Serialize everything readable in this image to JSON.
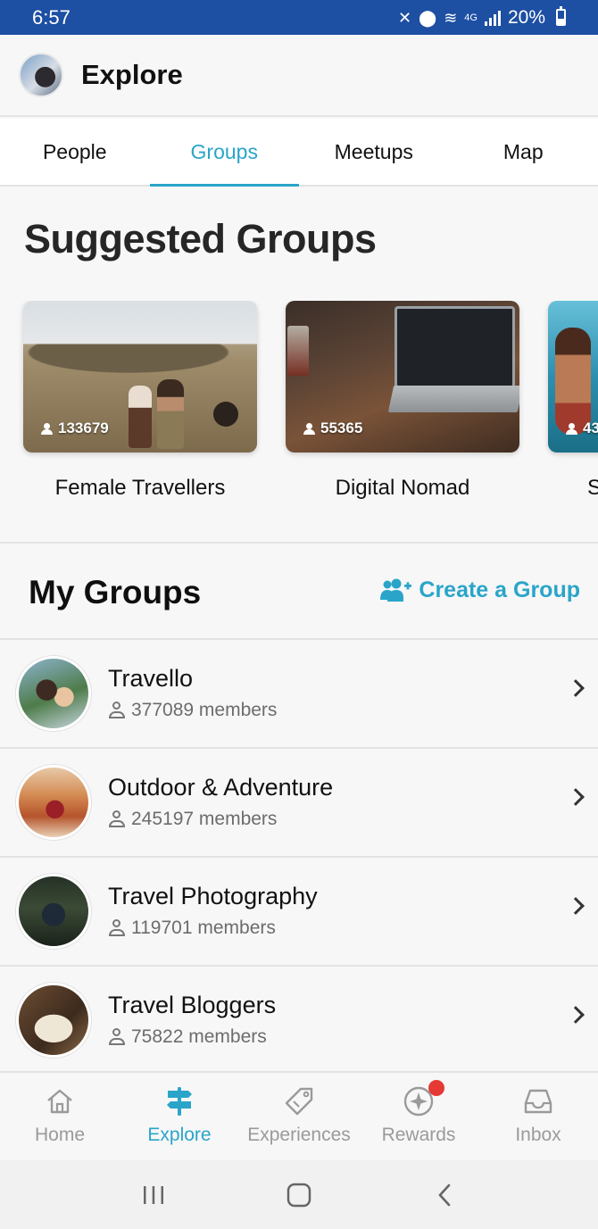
{
  "status_bar": {
    "time": "6:57",
    "network": "4G",
    "battery": "20%"
  },
  "header": {
    "title": "Explore"
  },
  "tabs": [
    {
      "label": "People",
      "active": false
    },
    {
      "label": "Groups",
      "active": true
    },
    {
      "label": "Meetups",
      "active": false
    },
    {
      "label": "Map",
      "active": false
    }
  ],
  "suggested": {
    "title": "Suggested Groups",
    "cards": [
      {
        "name": "Female Travellers",
        "members": "133679"
      },
      {
        "name": "Digital Nomad",
        "members": "55365"
      },
      {
        "name": "S",
        "members": "43"
      }
    ]
  },
  "my_groups": {
    "title": "My Groups",
    "create_label": "Create a Group",
    "items": [
      {
        "name": "Travello",
        "members": "377089 members"
      },
      {
        "name": "Outdoor & Adventure",
        "members": "245197 members"
      },
      {
        "name": "Travel Photography",
        "members": "119701 members"
      },
      {
        "name": "Travel Bloggers",
        "members": "75822 members"
      }
    ]
  },
  "bottom_nav": [
    {
      "label": "Home",
      "icon": "home-icon",
      "active": false
    },
    {
      "label": "Explore",
      "icon": "signpost-icon",
      "active": true
    },
    {
      "label": "Experiences",
      "icon": "tag-icon",
      "active": false
    },
    {
      "label": "Rewards",
      "icon": "star-badge-icon",
      "active": false,
      "notification": true
    },
    {
      "label": "Inbox",
      "icon": "inbox-icon",
      "active": false
    }
  ],
  "colors": {
    "accent": "#2aa5c9",
    "status_bar": "#1d4fa3",
    "badge": "#e53935"
  }
}
